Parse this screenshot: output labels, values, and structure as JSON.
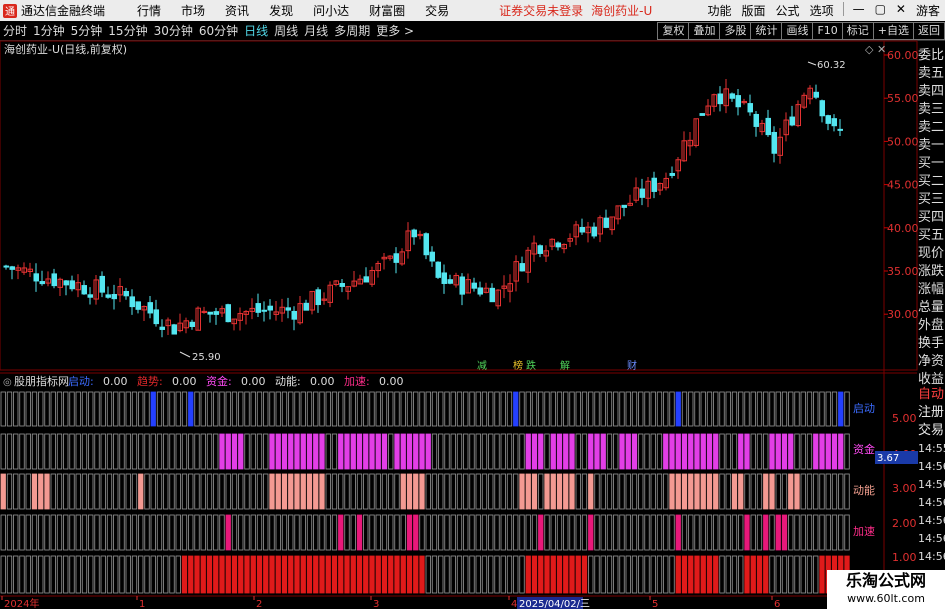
{
  "app": {
    "title": "通达信金融终端",
    "menu": [
      "行情",
      "市场",
      "资讯",
      "发现",
      "问小达",
      "财富圈",
      "交易"
    ],
    "notice": "证券交易未登录",
    "stock": "海创药业-U",
    "right_menu": [
      "功能",
      "版面",
      "公式",
      "选项"
    ],
    "guest": "游客"
  },
  "toolbar": {
    "periods": [
      "分时",
      "1分钟",
      "5分钟",
      "15分钟",
      "30分钟",
      "60分钟",
      "日线",
      "周线",
      "月线",
      "多周期",
      "更多 >"
    ],
    "active": "日线",
    "right": [
      "复权",
      "叠加",
      "多股",
      "统计",
      "画线",
      "F10",
      "标记",
      "+自选",
      "返回"
    ]
  },
  "chart_header": "海创药业-U(日线,前复权)",
  "price_axis": [
    "60.00",
    "55.00",
    "50.00",
    "45.00",
    "40.00",
    "35.00",
    "30.00"
  ],
  "labels": {
    "high": "60.32",
    "low": "25.90"
  },
  "events": [
    {
      "text": "减",
      "color": "#4fd35a"
    },
    {
      "text": "榜",
      "color": "#e8c229"
    },
    {
      "text": "跌",
      "color": "#4fd35a"
    },
    {
      "text": "解",
      "color": "#4fd35a"
    },
    {
      "text": "财",
      "color": "#6b8cff"
    }
  ],
  "indicator": {
    "name": "股朋指标网",
    "items": [
      {
        "label": "启动:",
        "value": "0.00",
        "color": "#3b6bff"
      },
      {
        "label": "趋势:",
        "value": "0.00",
        "color": "#e0282b"
      },
      {
        "label": "资金:",
        "value": "0.00",
        "color": "#ff4af4"
      },
      {
        "label": "动能:",
        "value": "0.00",
        "color": "#e0e0e0"
      },
      {
        "label": "加速:",
        "value": "0.00",
        "color": "#ff2d8a"
      }
    ],
    "row_labels": [
      "启动",
      "资金",
      "动能",
      "加速"
    ],
    "axis": [
      "5.00",
      "4.00",
      "3.00",
      "2.00",
      "1.00"
    ],
    "current": "3.67"
  },
  "date_axis": [
    "2024年",
    "1",
    "2",
    "3",
    "4",
    "2025/04/02/三",
    "5",
    "6"
  ],
  "right_panel": [
    "委比",
    "卖五",
    "卖四",
    "卖三",
    "卖二",
    "卖一",
    "买一",
    "买二",
    "买三",
    "买四",
    "买五",
    "现价",
    "涨跌",
    "涨幅",
    "总量",
    "外盘",
    "换手",
    "净资",
    "收益"
  ],
  "right_panel2": [
    "自动",
    "注册",
    "交易"
  ],
  "times": [
    "14:55",
    "14:56",
    "14:56",
    "14:56",
    "14:56",
    "14:56",
    "14:56",
    "14:56",
    "14:56"
  ],
  "watermark": {
    "title": "乐淘公式网",
    "url": "www.60lt.com"
  },
  "colors": {
    "up": "#e63232",
    "down": "#54e6f0",
    "grid": "#3a0000",
    "bar_empty": "#9a9a9a",
    "blue": "#2440ff",
    "magenta": "#e23ee6",
    "salmon": "#f39a92",
    "pink": "#e8187a",
    "red": "#e01a1a"
  }
}
